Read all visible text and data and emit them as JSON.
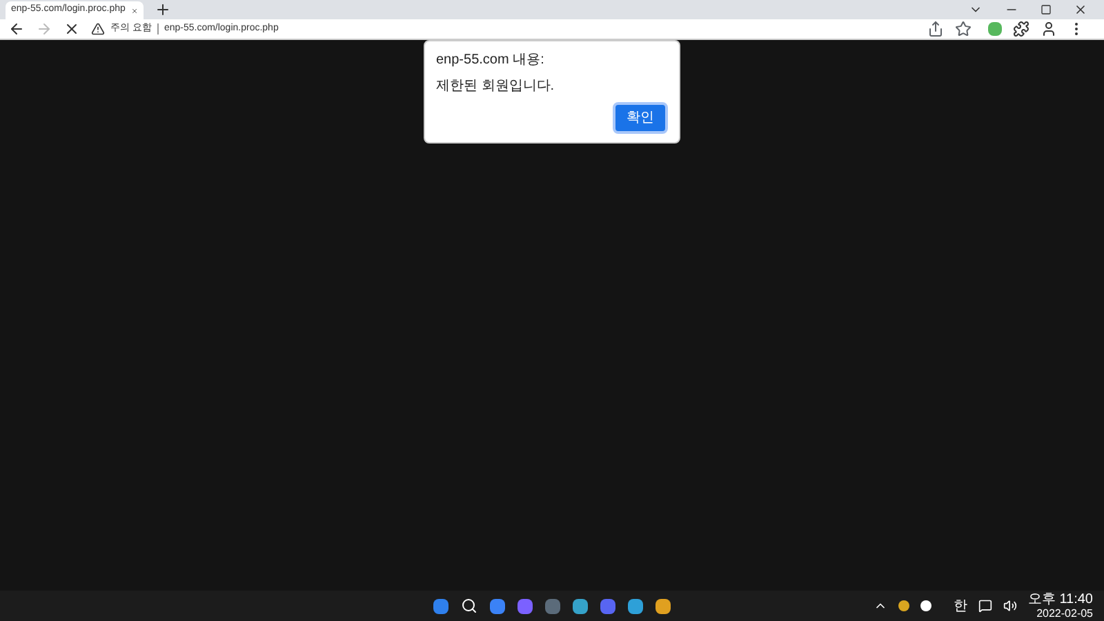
{
  "browser": {
    "tab": {
      "title": "enp-55.com/login.proc.php",
      "selected": true
    },
    "address_bar": {
      "security_label": "주의 요함",
      "url": "enp-55.com/login.proc.php"
    }
  },
  "dialog": {
    "title": "enp-55.com 내용:",
    "message": "제한된 회원입니다.",
    "buttons": [
      "확인"
    ]
  },
  "taskbar": {
    "input_indicator": "한",
    "clock": {
      "time": "오후 11:40",
      "date": "2022-02-05"
    }
  }
}
